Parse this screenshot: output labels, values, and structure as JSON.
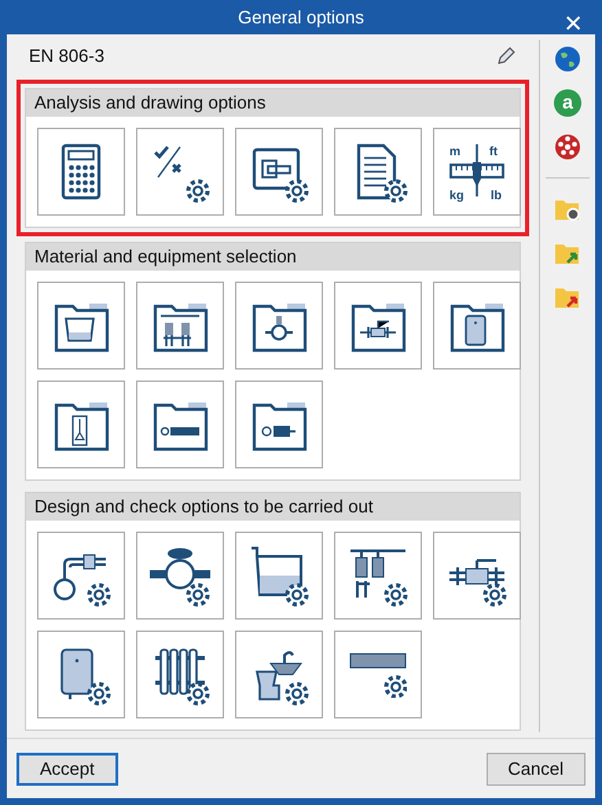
{
  "window": {
    "title": "General options",
    "close": "✕"
  },
  "standard": {
    "value": "EN 806-3"
  },
  "sections": [
    {
      "title": "Analysis and drawing options",
      "highlighted": true,
      "items": [
        {
          "kind": "calculator",
          "gear": false
        },
        {
          "kind": "check-cross",
          "gear": true
        },
        {
          "kind": "drawing",
          "gear": true
        },
        {
          "kind": "document",
          "gear": true
        },
        {
          "kind": "units",
          "gear": false,
          "labels": [
            "m",
            "ft",
            "kg",
            "lb"
          ]
        }
      ]
    },
    {
      "title": "Material and equipment selection",
      "highlighted": false,
      "items": [
        {
          "kind": "folder-tank",
          "gear": false
        },
        {
          "kind": "folder-pumps",
          "gear": false
        },
        {
          "kind": "folder-circulator",
          "gear": false
        },
        {
          "kind": "folder-valve",
          "gear": false
        },
        {
          "kind": "folder-heater",
          "gear": false
        },
        {
          "kind": "folder-column",
          "gear": false
        },
        {
          "kind": "folder-bar",
          "gear": false
        },
        {
          "kind": "folder-motor",
          "gear": false
        }
      ]
    },
    {
      "title": "Design and check options to be carried out",
      "highlighted": false,
      "items": [
        {
          "kind": "float-valve",
          "gear": true
        },
        {
          "kind": "meter",
          "gear": true
        },
        {
          "kind": "tank",
          "gear": true
        },
        {
          "kind": "pumps",
          "gear": true
        },
        {
          "kind": "valve",
          "gear": true
        },
        {
          "kind": "heater",
          "gear": true
        },
        {
          "kind": "radiator",
          "gear": true
        },
        {
          "kind": "sanitary",
          "gear": true
        },
        {
          "kind": "bar",
          "gear": true
        }
      ]
    }
  ],
  "sidebar": [
    {
      "kind": "globe"
    },
    {
      "kind": "letter",
      "glyph": "a"
    },
    {
      "kind": "red-disc"
    },
    {
      "kind": "separator"
    },
    {
      "kind": "folder-gear"
    },
    {
      "kind": "folder-green-arrow"
    },
    {
      "kind": "folder-red-arrow"
    }
  ],
  "buttons": [
    {
      "label": "Accept",
      "default": true
    },
    {
      "label": "Cancel",
      "default": false
    }
  ]
}
